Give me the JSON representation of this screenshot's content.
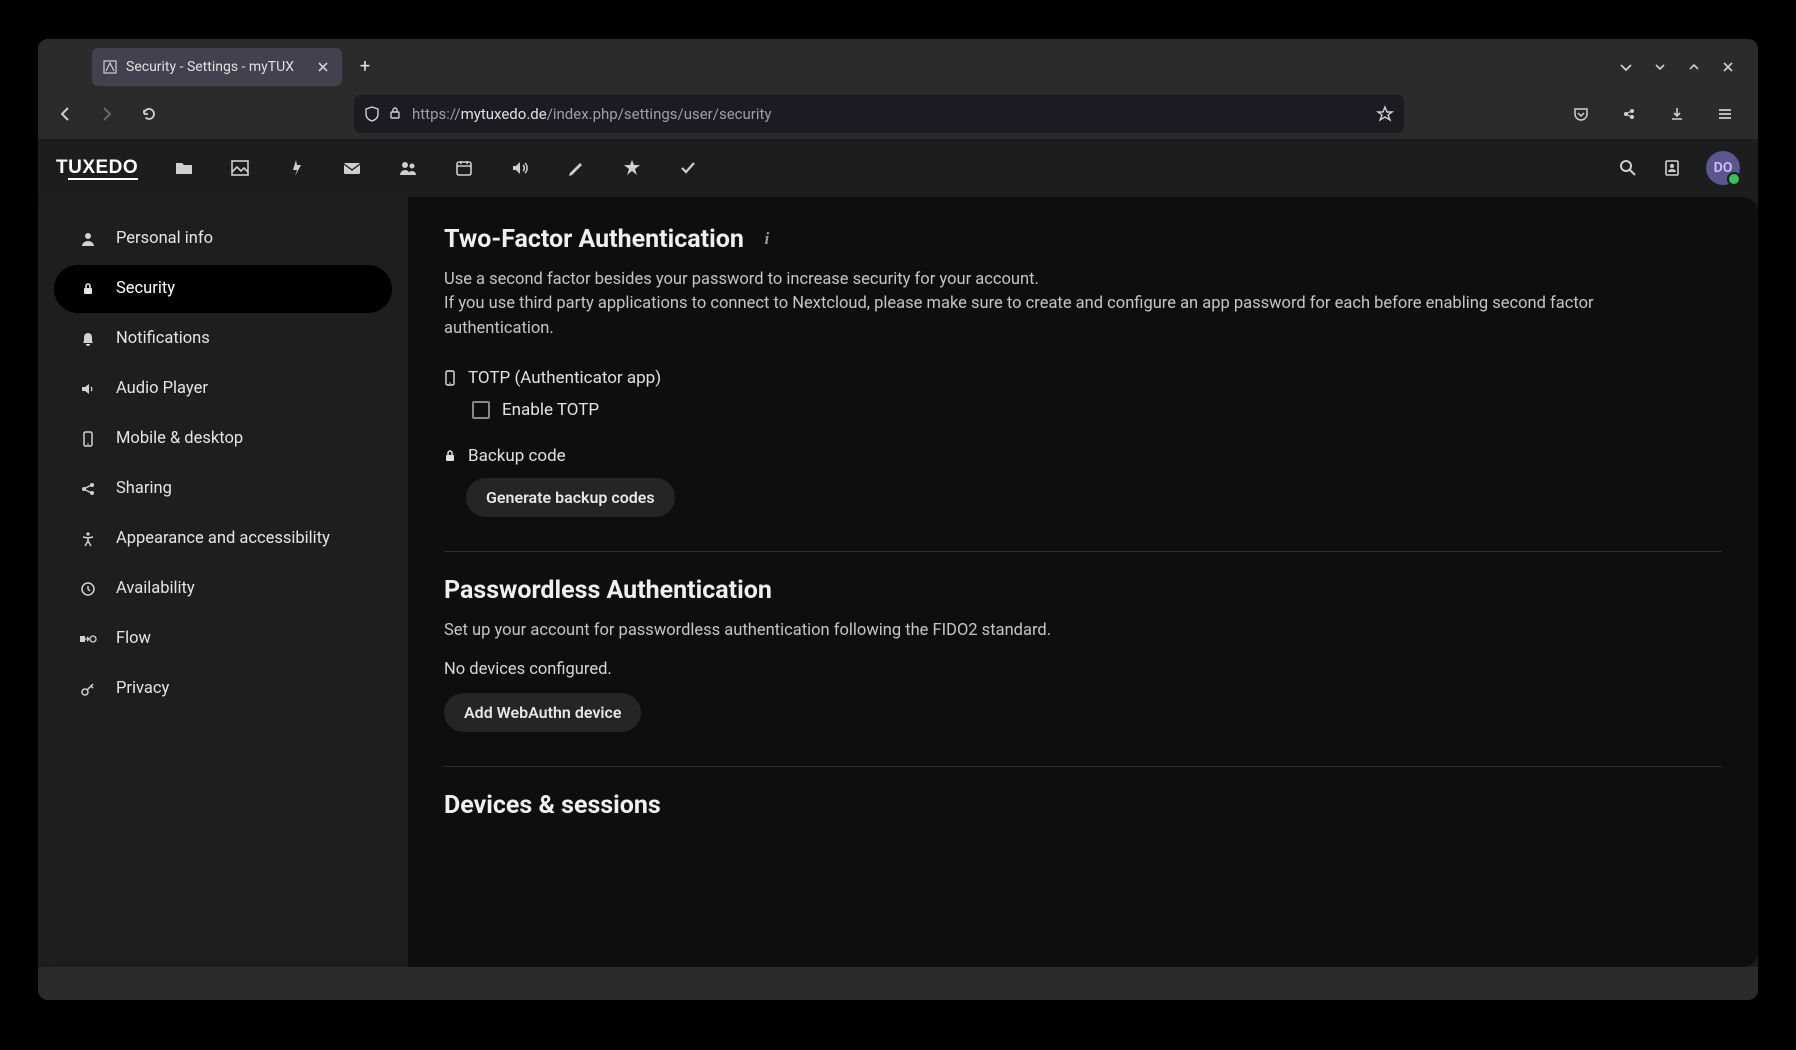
{
  "browser": {
    "tab_title": "Security - Settings - myTUX",
    "url_prefix": "https://",
    "url_host": "mytuxedo.de",
    "url_path": "/index.php/settings/user/security"
  },
  "app": {
    "logo": "TUXEDO",
    "avatar_initials": "DO"
  },
  "sidebar": {
    "items": [
      {
        "icon": "person",
        "label": "Personal info"
      },
      {
        "icon": "lock",
        "label": "Security"
      },
      {
        "icon": "bell",
        "label": "Notifications"
      },
      {
        "icon": "speaker",
        "label": "Audio Player"
      },
      {
        "icon": "phone",
        "label": "Mobile & desktop"
      },
      {
        "icon": "share",
        "label": "Sharing"
      },
      {
        "icon": "accessibility",
        "label": "Appearance and accessibility"
      },
      {
        "icon": "clock",
        "label": "Availability"
      },
      {
        "icon": "flow",
        "label": "Flow"
      },
      {
        "icon": "key",
        "label": "Privacy"
      }
    ],
    "active_index": 1
  },
  "main": {
    "twofa": {
      "heading": "Two-Factor Authentication",
      "desc1": "Use a second factor besides your password to increase security for your account.",
      "desc2": "If you use third party applications to connect to Nextcloud, please make sure to create and configure an app password for each before enabling second factor authentication.",
      "totp_label": "TOTP (Authenticator app)",
      "enable_totp_label": "Enable TOTP",
      "enable_totp_checked": false,
      "backup_label": "Backup code",
      "generate_button": "Generate backup codes"
    },
    "passwordless": {
      "heading": "Passwordless Authentication",
      "desc": "Set up your account for passwordless authentication following the FIDO2 standard.",
      "empty": "No devices configured.",
      "add_button": "Add WebAuthn device"
    },
    "devices": {
      "heading": "Devices & sessions"
    }
  }
}
